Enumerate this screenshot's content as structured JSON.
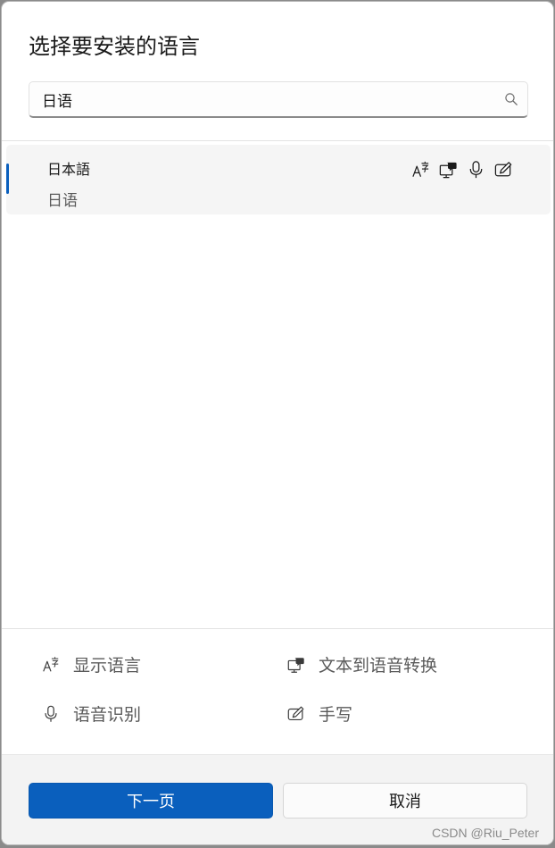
{
  "dialog": {
    "title": "选择要安装的语言"
  },
  "search": {
    "value": "日语",
    "icon": "search-icon"
  },
  "languages": [
    {
      "native_name": "日本語",
      "local_name": "日语",
      "selected": true,
      "features": [
        "display-language-icon",
        "text-to-speech-icon",
        "speech-recognition-icon",
        "handwriting-icon"
      ]
    }
  ],
  "legend": {
    "display_language": "显示语言",
    "text_to_speech": "文本到语音转换",
    "speech_recognition": "语音识别",
    "handwriting": "手写"
  },
  "footer": {
    "next_label": "下一页",
    "cancel_label": "取消"
  },
  "watermark": "CSDN @Riu_Peter",
  "colors": {
    "accent": "#0a5fbd",
    "selected_row": "#f5f5f5",
    "footer_bg": "#f3f3f3"
  }
}
